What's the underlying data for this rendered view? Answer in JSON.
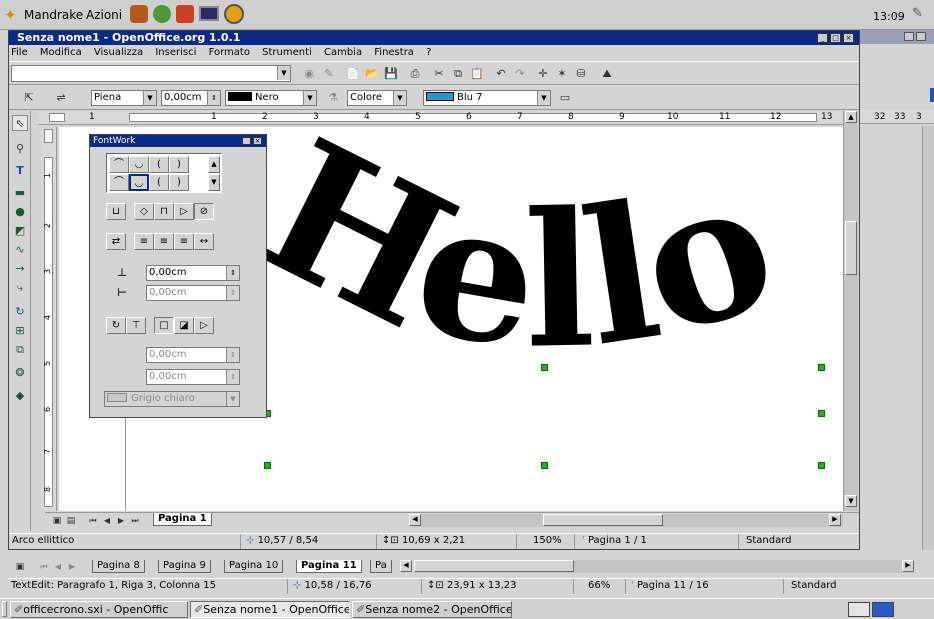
{
  "panel": {
    "menu1": "Mandrake",
    "menu2": "Azioni",
    "clock": "13:09"
  },
  "window": {
    "title": "Senza nome1 - OpenOffice.org 1.0.1"
  },
  "menubar": {
    "items": [
      "File",
      "Modifica",
      "Visualizza",
      "Inserisci",
      "Formato",
      "Strumenti",
      "Cambia",
      "Finestra",
      "?"
    ]
  },
  "linebar": {
    "line_style": "Piena",
    "line_width": "0,00cm",
    "line_color": "Nero",
    "area_style": "Colore",
    "area_color": "Blu 7"
  },
  "ruler": {
    "labels": [
      "1",
      "1",
      "2",
      "3",
      "4",
      "5",
      "6",
      "7",
      "8",
      "9",
      "10",
      "11",
      "12",
      "13"
    ],
    "right_numbers": [
      "32",
      "33",
      "3"
    ],
    "vlabels": [
      "1",
      "2",
      "3",
      "4",
      "5",
      "6",
      "7",
      "8"
    ]
  },
  "fontwork": {
    "title": "FontWork",
    "distance": "0,00cm",
    "indent": "0,00cm",
    "shadow_x": "0,00cm",
    "shadow_y": "0,00cm",
    "shadow_color": "Grigio chiaro"
  },
  "canvas": {
    "text": "Hello"
  },
  "doc_tabs": {
    "active": "Pagina 1"
  },
  "statusbar1": {
    "info": "Arco ellittico",
    "position": "10,57 / 8,54",
    "size": "10,69 x 2,21",
    "zoom": "150%",
    "page": "Pagina 1 / 1",
    "style": "Standard"
  },
  "back_tabs": {
    "items": [
      "Pagina 8",
      "Pagina 9",
      "Pagina 10",
      "Pagina 11",
      "Pa"
    ]
  },
  "statusbar2": {
    "info": "TextEdit: Paragrafo 1, Riga 3, Colonna 15",
    "position": "10,58 / 16,76",
    "size": "23,91 x 13,23",
    "zoom": "66%",
    "page": "Pagina 11 / 16",
    "style": "Standard"
  },
  "taskbar": {
    "items": [
      "officecrono.sxi - OpenOffic",
      "Senza nome1 - OpenOffice",
      "Senza nome2 - OpenOffice"
    ]
  },
  "colors": {
    "title_active": "#0a2a8a",
    "title_inactive": "#9aa0b8",
    "selection_handle": "#1bb31b",
    "blu7": "#1e9bd6"
  }
}
